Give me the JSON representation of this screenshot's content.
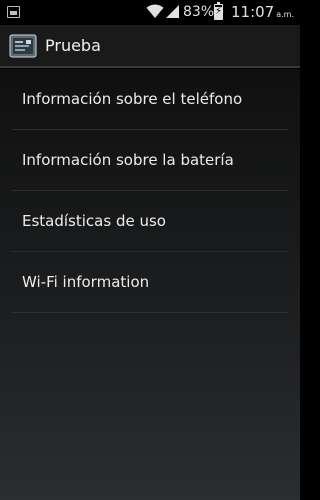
{
  "status_bar": {
    "battery_percent": "83%",
    "battery_level": 0.83,
    "time": "11:07",
    "ampm": "a.m.",
    "icons": [
      "notification-icon",
      "wifi-icon",
      "signal-icon",
      "battery-charging-icon"
    ]
  },
  "action_bar": {
    "title": "Prueba",
    "icon": "app-icon"
  },
  "menu": {
    "items": [
      {
        "label": "Información sobre el teléfono"
      },
      {
        "label": "Información sobre la batería"
      },
      {
        "label": "Estadísticas de uso"
      },
      {
        "label": "Wi-Fi information"
      }
    ]
  }
}
